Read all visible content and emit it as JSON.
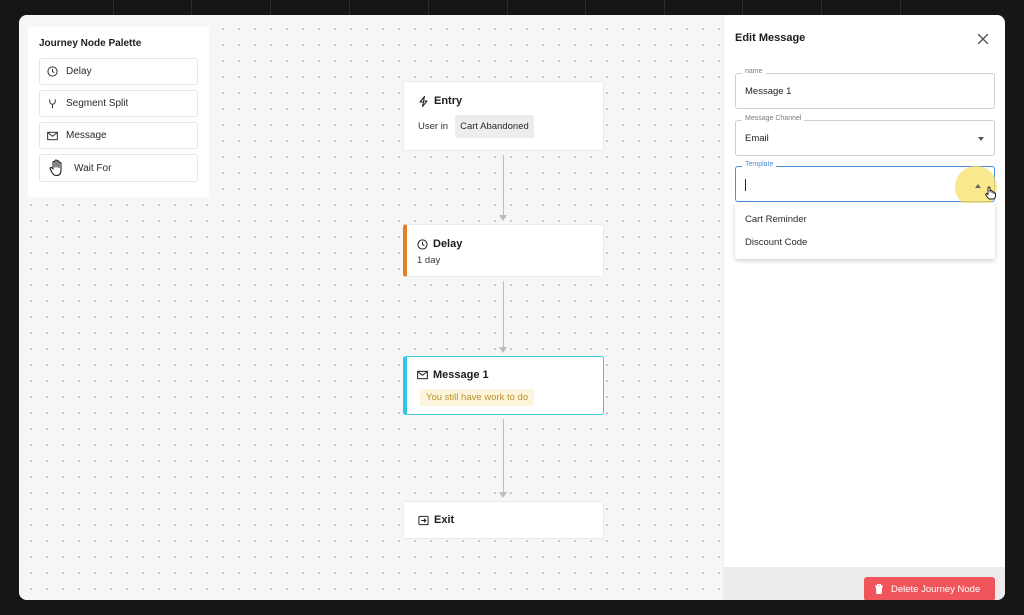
{
  "palette": {
    "title": "Journey Node Palette",
    "items": [
      {
        "label": "Delay",
        "icon": "clock-icon"
      },
      {
        "label": "Segment Split",
        "icon": "fork-icon"
      },
      {
        "label": "Message",
        "icon": "mail-icon"
      },
      {
        "label": "Wait For",
        "icon": "hand-icon"
      }
    ]
  },
  "flow": {
    "entry": {
      "title": "Entry",
      "prefix": "User in",
      "segment": "Cart Abandoned"
    },
    "delay": {
      "title": "Delay",
      "value": "1 day",
      "accent": "#e07f26"
    },
    "message": {
      "title": "Message 1",
      "warning": "You still have work to do",
      "accent": "#2fc6e6"
    },
    "exit": {
      "title": "Exit"
    }
  },
  "panel": {
    "title": "Edit Message",
    "name_field": {
      "label": "name",
      "value": "Message 1"
    },
    "channel_field": {
      "label": "Message Channel",
      "value": "Email"
    },
    "template_field": {
      "label": "Template",
      "value": ""
    },
    "template_options": [
      "Cart Reminder",
      "Discount Code"
    ],
    "delete_label": "Delete Journey Node",
    "delete_color": "#f0555c"
  }
}
